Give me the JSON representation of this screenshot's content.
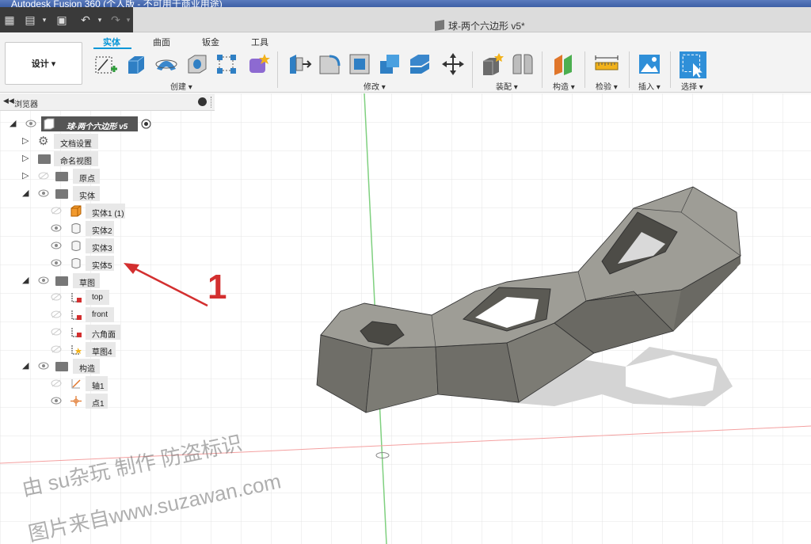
{
  "app": {
    "window_title": "Autodesk Fusion 360 (个人版 - 不可用于商业用途)",
    "document_title": "球-两个六边形 v5*"
  },
  "toolbar": {
    "workspace": "设计 ▾",
    "tabs": [
      {
        "label": "实体",
        "active": true
      },
      {
        "label": "曲面",
        "active": false
      },
      {
        "label": "钣金",
        "active": false
      },
      {
        "label": "工具",
        "active": false
      }
    ],
    "groups": [
      {
        "label": "创建 ▾"
      },
      {
        "label": "修改 ▾"
      },
      {
        "label": "装配 ▾"
      },
      {
        "label": "构造 ▾"
      },
      {
        "label": "检验 ▾"
      },
      {
        "label": "插入 ▾"
      },
      {
        "label": "选择 ▾"
      }
    ]
  },
  "browser": {
    "title": "浏览器",
    "root": "球-两个六边形 v5",
    "nodes": [
      {
        "label": "文档设置"
      },
      {
        "label": "命名视图"
      },
      {
        "label": "原点"
      },
      {
        "label": "实体"
      },
      {
        "label": "实体1 (1)"
      },
      {
        "label": "实体2"
      },
      {
        "label": "实体3"
      },
      {
        "label": "实体5"
      },
      {
        "label": "草图"
      },
      {
        "label": "top"
      },
      {
        "label": "front"
      },
      {
        "label": "六角面"
      },
      {
        "label": "草图4"
      },
      {
        "label": "构造"
      },
      {
        "label": "轴1"
      },
      {
        "label": "点1"
      }
    ]
  },
  "annotation": {
    "number": "1"
  },
  "watermark": {
    "line1": "由 su杂玩 制作 防盗标识",
    "line2": "图片来自www.suzawan.com"
  },
  "colors": {
    "accent": "#0696d7",
    "annotation_red": "#d32f2f",
    "model_gray": "#77766f"
  }
}
